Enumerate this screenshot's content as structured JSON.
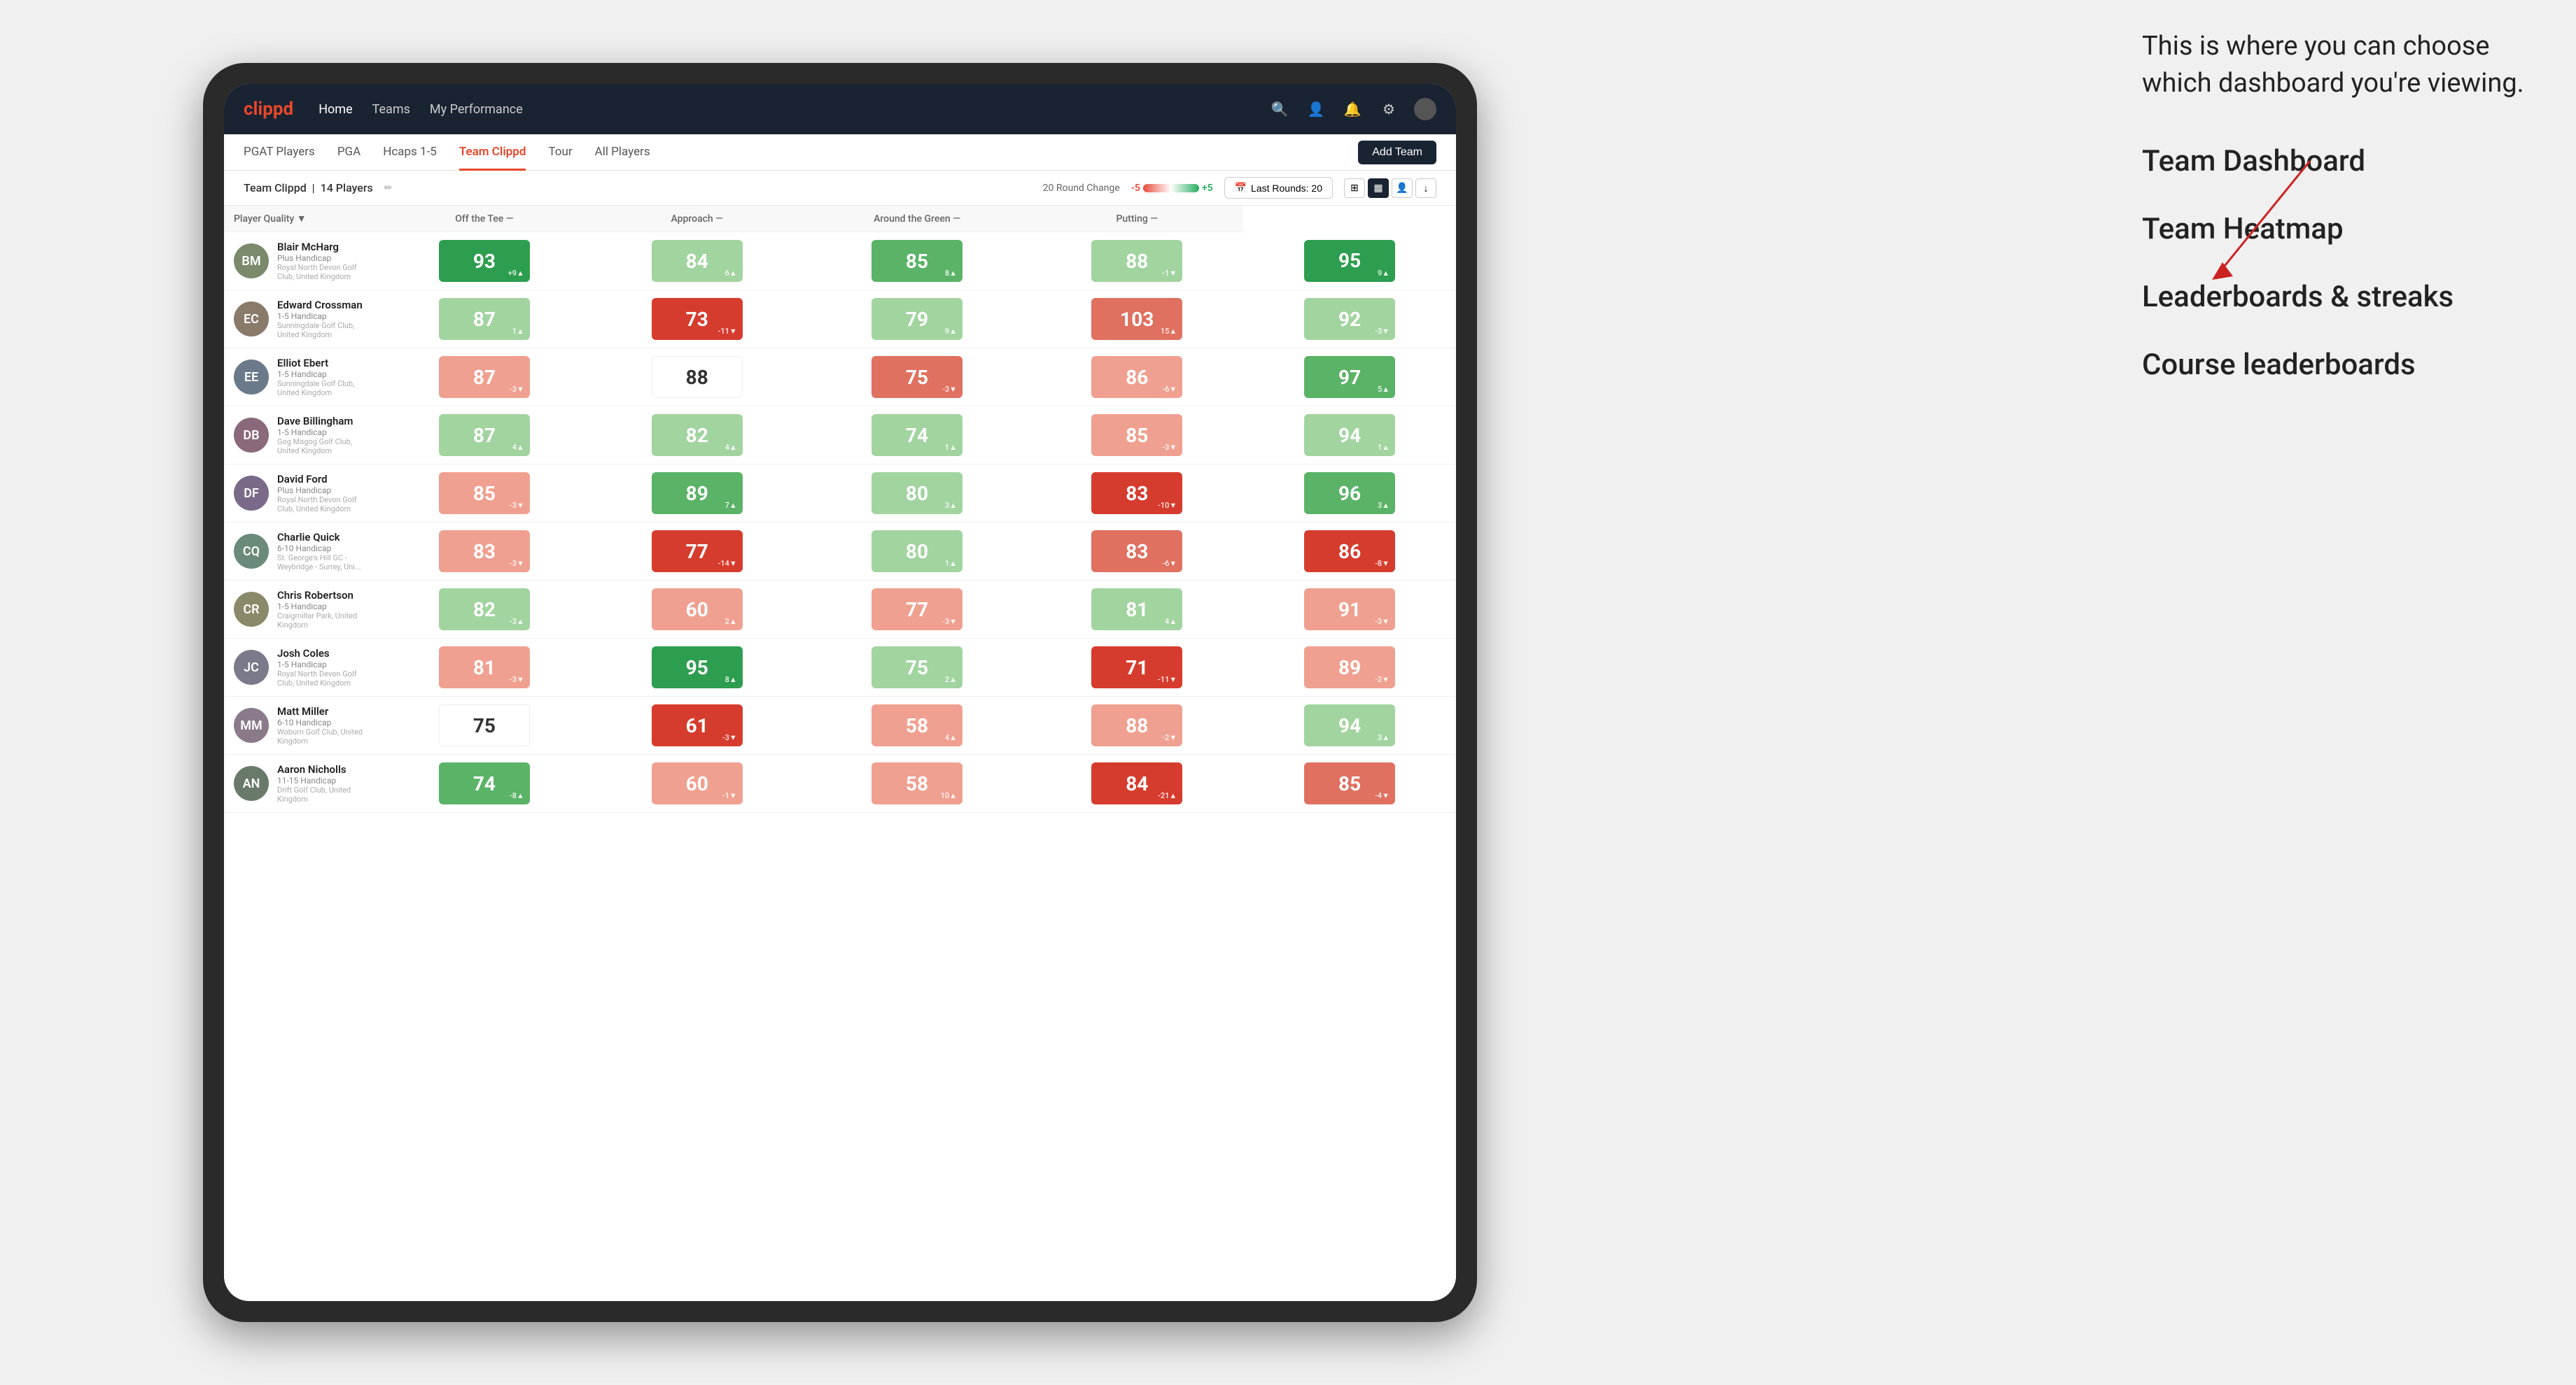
{
  "annotation": {
    "intro_text": "This is where you can choose which dashboard you're viewing.",
    "options": [
      "Team Dashboard",
      "Team Heatmap",
      "Leaderboards & streaks",
      "Course leaderboards"
    ]
  },
  "nav": {
    "logo": "clippd",
    "links": [
      "Home",
      "Teams",
      "My Performance"
    ],
    "active_link": "Home"
  },
  "tabs": {
    "items": [
      "PGAT Players",
      "PGA",
      "Hcaps 1-5",
      "Team Clippd",
      "Tour",
      "All Players"
    ],
    "active": "Team Clippd",
    "add_team_label": "Add Team"
  },
  "subheader": {
    "team_name": "Team Clippd",
    "player_count": "14 Players",
    "round_change_label": "20 Round Change",
    "minus_label": "-5",
    "plus_label": "+5",
    "last_rounds_label": "Last Rounds: 20"
  },
  "table": {
    "headers": {
      "player": "Player Quality ▼",
      "off_tee": "Off the Tee —",
      "approach": "Approach —",
      "around_green": "Around the Green —",
      "putting": "Putting —"
    },
    "rows": [
      {
        "name": "Blair McHarg",
        "handicap": "Plus Handicap",
        "club": "Royal North Devon Golf Club, United Kingdom",
        "avatar_color": "#7a8a6a",
        "scores": {
          "quality": {
            "value": "93",
            "delta": "+9▲",
            "color": "green-dark"
          },
          "off_tee": {
            "value": "84",
            "delta": "6▲",
            "color": "green-light"
          },
          "approach": {
            "value": "85",
            "delta": "8▲",
            "color": "green-mid"
          },
          "around": {
            "value": "88",
            "delta": "-1▼",
            "color": "green-light"
          },
          "putting": {
            "value": "95",
            "delta": "9▲",
            "color": "green-dark"
          }
        }
      },
      {
        "name": "Edward Crossman",
        "handicap": "1-5 Handicap",
        "club": "Sunningdale Golf Club, United Kingdom",
        "avatar_color": "#8a7a6a",
        "scores": {
          "quality": {
            "value": "87",
            "delta": "1▲",
            "color": "green-light"
          },
          "off_tee": {
            "value": "73",
            "delta": "-11▼",
            "color": "red-dark"
          },
          "approach": {
            "value": "79",
            "delta": "9▲",
            "color": "green-light"
          },
          "around": {
            "value": "103",
            "delta": "15▲",
            "color": "red-mid"
          },
          "putting": {
            "value": "92",
            "delta": "-3▼",
            "color": "green-light"
          }
        }
      },
      {
        "name": "Elliot Ebert",
        "handicap": "1-5 Handicap",
        "club": "Sunningdale Golf Club, United Kingdom",
        "avatar_color": "#6a7a8a",
        "scores": {
          "quality": {
            "value": "87",
            "delta": "-3▼",
            "color": "red-light"
          },
          "off_tee": {
            "value": "88",
            "delta": "",
            "color": "white-bg"
          },
          "approach": {
            "value": "75",
            "delta": "-3▼",
            "color": "red-mid"
          },
          "around": {
            "value": "86",
            "delta": "-6▼",
            "color": "red-light"
          },
          "putting": {
            "value": "97",
            "delta": "5▲",
            "color": "green-mid"
          }
        }
      },
      {
        "name": "Dave Billingham",
        "handicap": "1-5 Handicap",
        "club": "Gog Magog Golf Club, United Kingdom",
        "avatar_color": "#8a6a7a",
        "scores": {
          "quality": {
            "value": "87",
            "delta": "4▲",
            "color": "green-light"
          },
          "off_tee": {
            "value": "82",
            "delta": "4▲",
            "color": "green-light"
          },
          "approach": {
            "value": "74",
            "delta": "1▲",
            "color": "green-light"
          },
          "around": {
            "value": "85",
            "delta": "-3▼",
            "color": "red-light"
          },
          "putting": {
            "value": "94",
            "delta": "1▲",
            "color": "green-light"
          }
        }
      },
      {
        "name": "David Ford",
        "handicap": "Plus Handicap",
        "club": "Royal North Devon Golf Club, United Kingdom",
        "avatar_color": "#7a6a8a",
        "scores": {
          "quality": {
            "value": "85",
            "delta": "-3▼",
            "color": "red-light"
          },
          "off_tee": {
            "value": "89",
            "delta": "7▲",
            "color": "green-mid"
          },
          "approach": {
            "value": "80",
            "delta": "3▲",
            "color": "green-light"
          },
          "around": {
            "value": "83",
            "delta": "-10▼",
            "color": "red-dark"
          },
          "putting": {
            "value": "96",
            "delta": "3▲",
            "color": "green-mid"
          }
        }
      },
      {
        "name": "Charlie Quick",
        "handicap": "6-10 Handicap",
        "club": "St. George's Hill GC - Weybridge - Surrey, Uni...",
        "avatar_color": "#6a8a7a",
        "scores": {
          "quality": {
            "value": "83",
            "delta": "-3▼",
            "color": "red-light"
          },
          "off_tee": {
            "value": "77",
            "delta": "-14▼",
            "color": "red-dark"
          },
          "approach": {
            "value": "80",
            "delta": "1▲",
            "color": "green-light"
          },
          "around": {
            "value": "83",
            "delta": "-6▼",
            "color": "red-mid"
          },
          "putting": {
            "value": "86",
            "delta": "-8▼",
            "color": "red-dark"
          }
        }
      },
      {
        "name": "Chris Robertson",
        "handicap": "1-5 Handicap",
        "club": "Craigmillar Park, United Kingdom",
        "avatar_color": "#8a8a6a",
        "scores": {
          "quality": {
            "value": "82",
            "delta": "-3▲",
            "color": "green-light"
          },
          "off_tee": {
            "value": "60",
            "delta": "2▲",
            "color": "red-light"
          },
          "approach": {
            "value": "77",
            "delta": "-3▼",
            "color": "red-light"
          },
          "around": {
            "value": "81",
            "delta": "4▲",
            "color": "green-light"
          },
          "putting": {
            "value": "91",
            "delta": "-3▼",
            "color": "red-light"
          }
        }
      },
      {
        "name": "Josh Coles",
        "handicap": "1-5 Handicap",
        "club": "Royal North Devon Golf Club, United Kingdom",
        "avatar_color": "#7a7a8a",
        "scores": {
          "quality": {
            "value": "81",
            "delta": "-3▼",
            "color": "red-light"
          },
          "off_tee": {
            "value": "95",
            "delta": "8▲",
            "color": "green-dark"
          },
          "approach": {
            "value": "75",
            "delta": "2▲",
            "color": "green-light"
          },
          "around": {
            "value": "71",
            "delta": "-11▼",
            "color": "red-dark"
          },
          "putting": {
            "value": "89",
            "delta": "-2▼",
            "color": "red-light"
          }
        }
      },
      {
        "name": "Matt Miller",
        "handicap": "6-10 Handicap",
        "club": "Woburn Golf Club, United Kingdom",
        "avatar_color": "#8a7a8a",
        "scores": {
          "quality": {
            "value": "75",
            "delta": "",
            "color": "white-bg"
          },
          "off_tee": {
            "value": "61",
            "delta": "-3▼",
            "color": "red-dark"
          },
          "approach": {
            "value": "58",
            "delta": "4▲",
            "color": "red-light"
          },
          "around": {
            "value": "88",
            "delta": "-2▼",
            "color": "red-light"
          },
          "putting": {
            "value": "94",
            "delta": "3▲",
            "color": "green-light"
          }
        }
      },
      {
        "name": "Aaron Nicholls",
        "handicap": "11-15 Handicap",
        "club": "Drift Golf Club, United Kingdom",
        "avatar_color": "#6a7a6a",
        "scores": {
          "quality": {
            "value": "74",
            "delta": "-8▲",
            "color": "green-mid"
          },
          "off_tee": {
            "value": "60",
            "delta": "-1▼",
            "color": "red-light"
          },
          "approach": {
            "value": "58",
            "delta": "10▲",
            "color": "red-light"
          },
          "around": {
            "value": "84",
            "delta": "-21▲",
            "color": "red-dark"
          },
          "putting": {
            "value": "85",
            "delta": "-4▼",
            "color": "red-mid"
          }
        }
      }
    ]
  }
}
